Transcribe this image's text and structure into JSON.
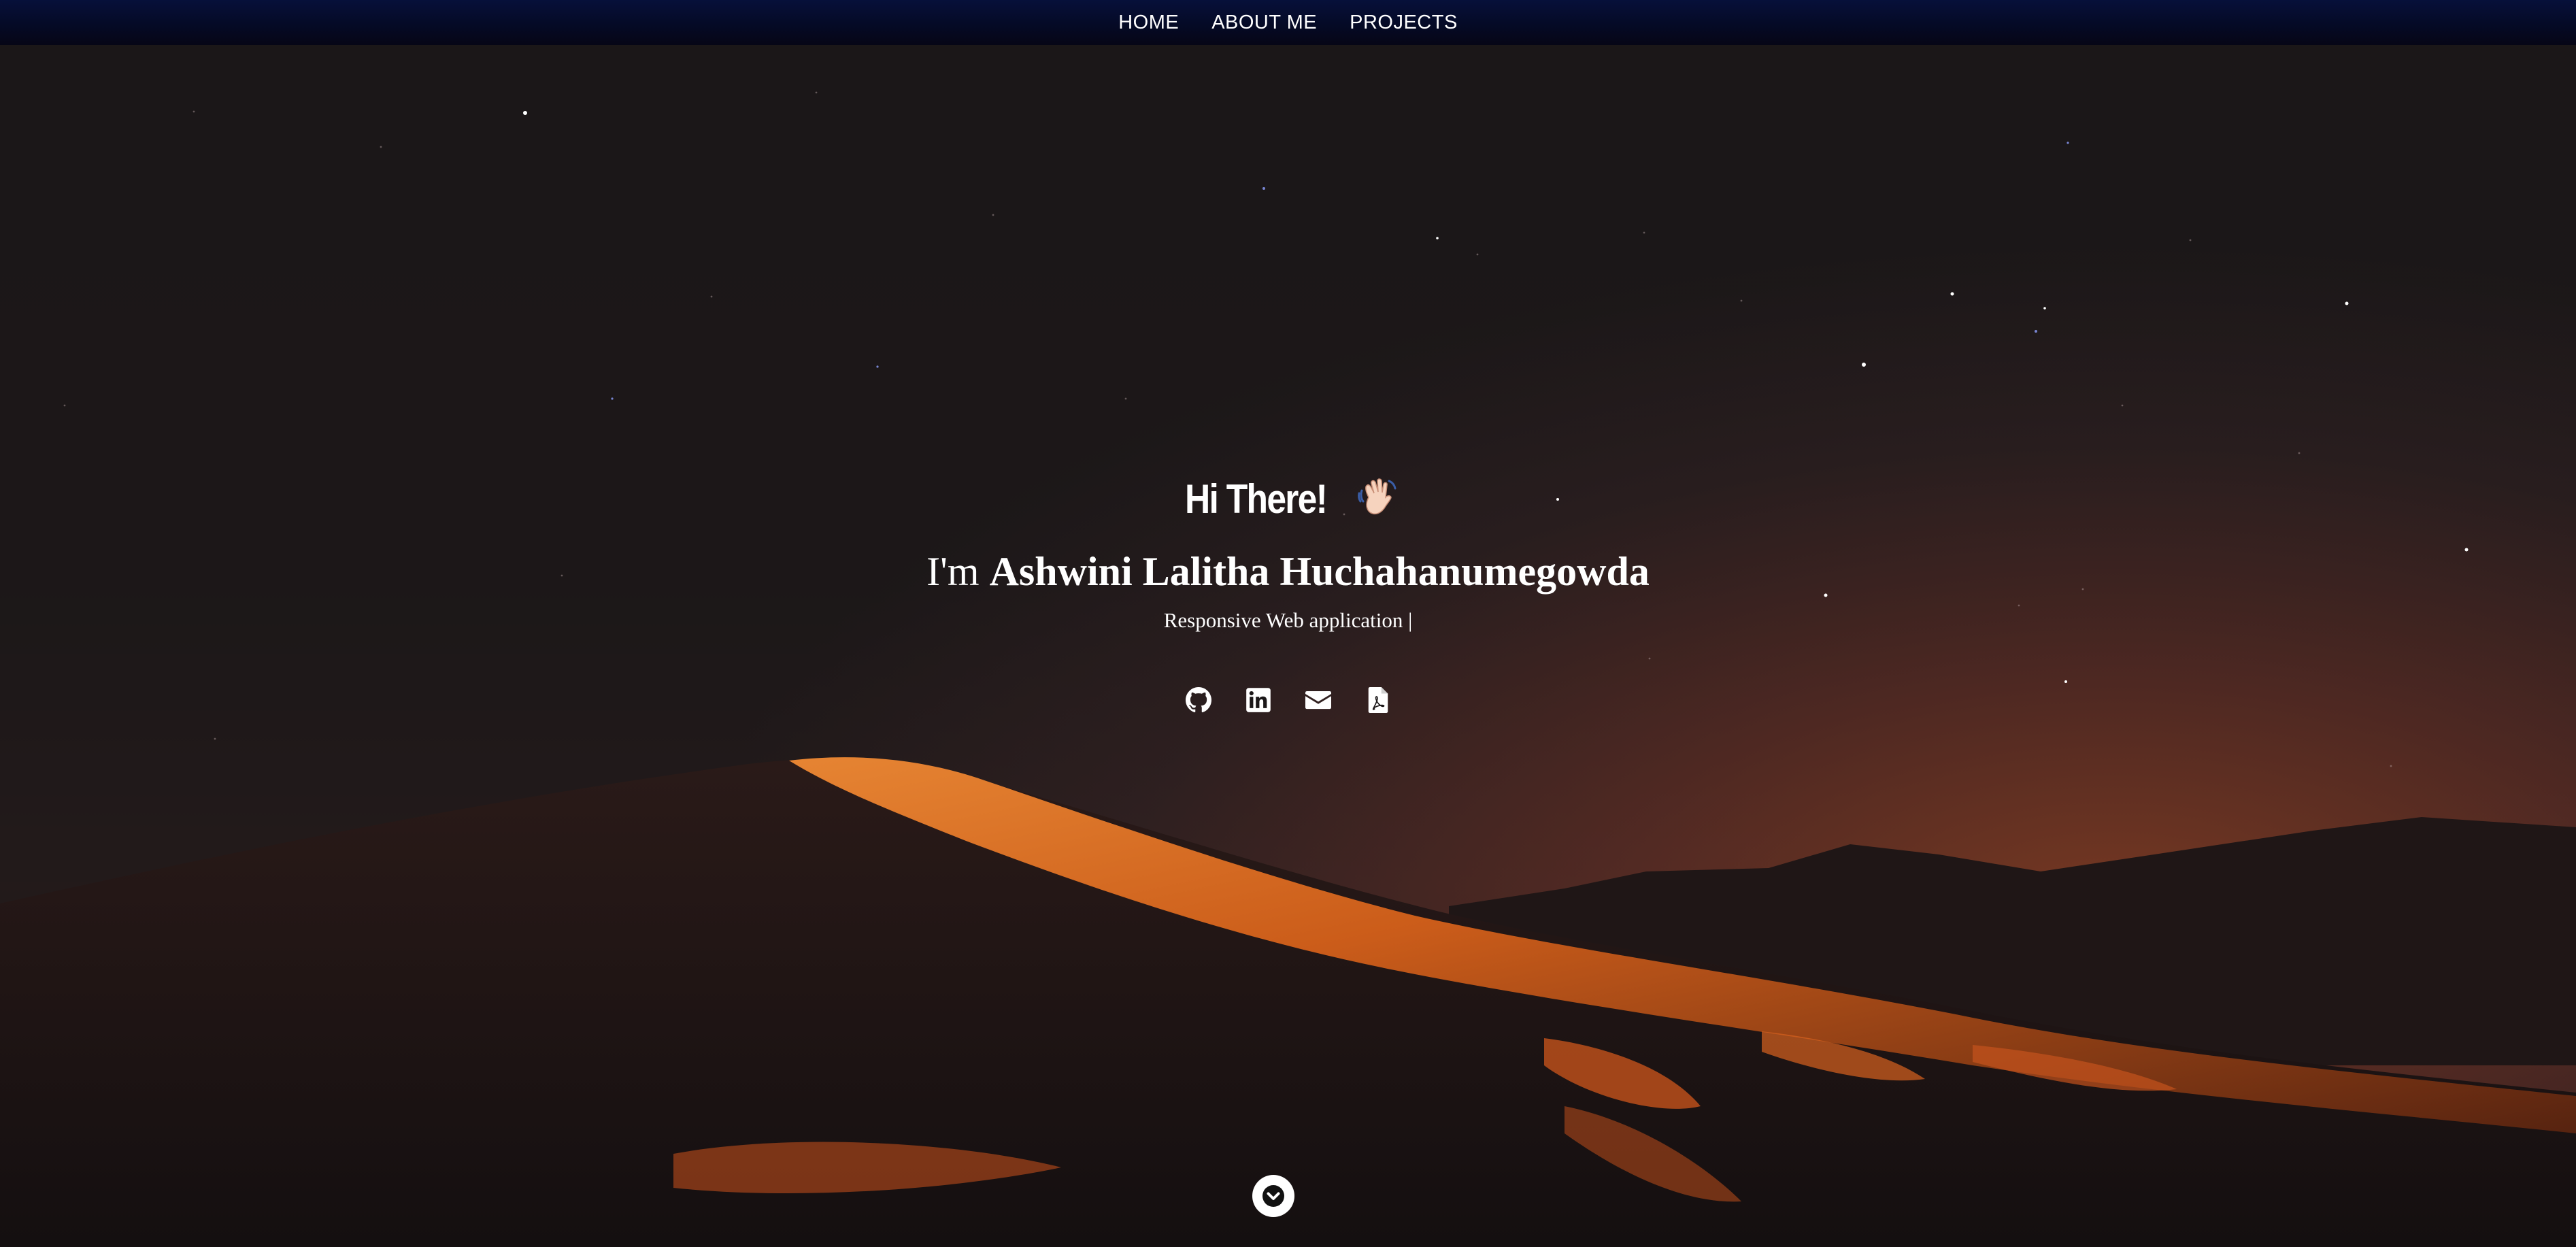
{
  "nav": {
    "items": [
      {
        "label": "HOME"
      },
      {
        "label": "ABOUT ME"
      },
      {
        "label": "PROJECTS"
      }
    ]
  },
  "hero": {
    "greeting": "Hi There!",
    "wave_icon": "waving-hand-icon",
    "name_prefix": "I'm",
    "name": "Ashwini Lalitha Huchahanumegowda",
    "subtitle": "Responsive Web application |"
  },
  "socials": [
    {
      "icon": "github-icon"
    },
    {
      "icon": "linkedin-icon"
    },
    {
      "icon": "email-icon"
    },
    {
      "icon": "pdf-icon"
    }
  ],
  "scroll_icon": "chevron-down-icon",
  "colors": {
    "nav_bg": "#050a26",
    "sky": "#1b1718",
    "dune_glow": "#e06a20",
    "text": "#ffffff"
  }
}
